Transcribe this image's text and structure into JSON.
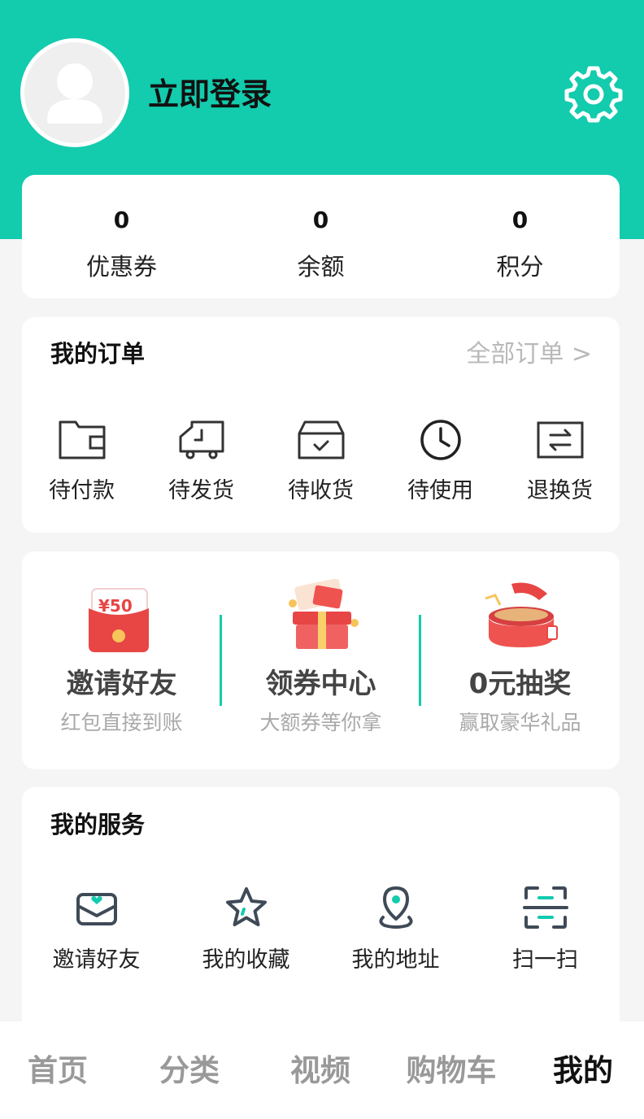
{
  "header": {
    "login_label": "立即登录",
    "avatar_icon": "default-avatar-icon",
    "settings_icon": "gear-icon",
    "bg_color": "#13cbad"
  },
  "stats": [
    {
      "value": "0",
      "label": "优惠券"
    },
    {
      "value": "0",
      "label": "余额"
    },
    {
      "value": "0",
      "label": "积分"
    }
  ],
  "orders": {
    "title": "我的订单",
    "all_link": "全部订单 >",
    "items": [
      {
        "label": "待付款",
        "icon": "wallet-icon"
      },
      {
        "label": "待发货",
        "icon": "truck-icon"
      },
      {
        "label": "待收货",
        "icon": "inbox-check-icon"
      },
      {
        "label": "待使用",
        "icon": "clock-icon"
      },
      {
        "label": "退换货",
        "icon": "exchange-icon"
      }
    ]
  },
  "promos": [
    {
      "title": "邀请好友",
      "subtitle": "红包直接到账",
      "icon": "red-envelope-icon",
      "badge": "¥50"
    },
    {
      "title": "领券中心",
      "subtitle": "大额券等你拿",
      "icon": "gift-box-icon"
    },
    {
      "title": "0元抽奖",
      "subtitle": "赢取豪华礼品",
      "icon": "treasure-box-icon"
    }
  ],
  "services": {
    "title": "我的服务",
    "items": [
      {
        "label": "邀请好友",
        "icon": "envelope-heart-icon"
      },
      {
        "label": "我的收藏",
        "icon": "star-icon"
      },
      {
        "label": "我的地址",
        "icon": "location-pin-icon"
      },
      {
        "label": "扫一扫",
        "icon": "scan-icon"
      }
    ]
  },
  "tabbar": {
    "tabs": [
      {
        "label": "首页",
        "active": false
      },
      {
        "label": "分类",
        "active": false
      },
      {
        "label": "视频",
        "active": false
      },
      {
        "label": "购物车",
        "active": false
      },
      {
        "label": "我的",
        "active": true
      }
    ]
  }
}
